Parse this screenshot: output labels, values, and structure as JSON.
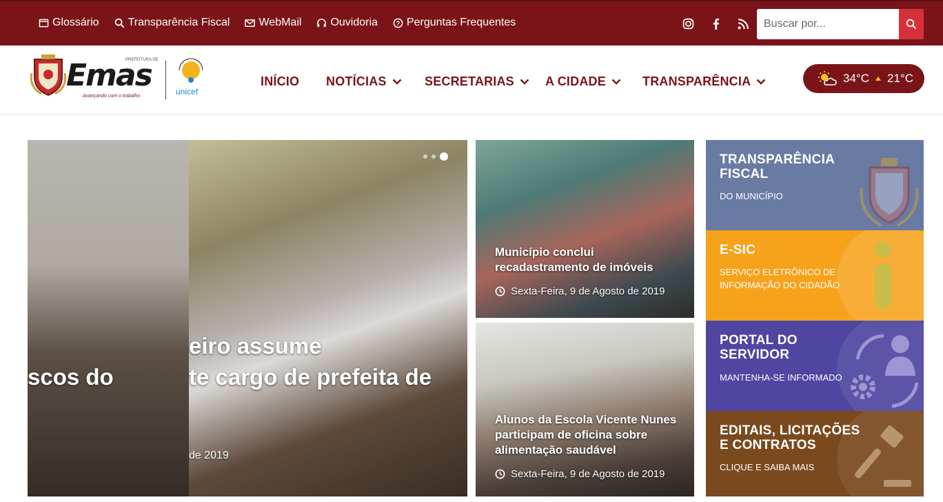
{
  "topbar": {
    "links": [
      {
        "label": "Glossário",
        "icon": "book-icon"
      },
      {
        "label": "Transparência Fiscal",
        "icon": "search-icon"
      },
      {
        "label": "WebMail",
        "icon": "envelope-icon"
      },
      {
        "label": "Ouvidoria",
        "icon": "headset-icon"
      },
      {
        "label": "Perguntas Frequentes",
        "icon": "question-circle-icon"
      }
    ],
    "socials": [
      "instagram-icon",
      "facebook-icon",
      "rss-icon"
    ],
    "search_placeholder": "Buscar por..."
  },
  "header": {
    "logo_text": "Emas",
    "logo_prefix": "PREFEITURA DE",
    "logo_tagline": "Avançando com o trabalho",
    "partner_text": "unicef",
    "nav": [
      "INÍCIO",
      "NOTÍCIAS",
      "SECRETARIAS",
      "A CIDADE",
      "TRANSPARÊNCIA"
    ],
    "weather": {
      "max": "34°C",
      "min": "21°C"
    }
  },
  "slider": {
    "slide_prev_title": "scos do",
    "slide_title_line1": "eiro assume",
    "slide_title_line2": "te cargo de prefeita de",
    "slide_date": "de 2019",
    "active_index": 2,
    "dot_count": 3
  },
  "news": [
    {
      "title": "Município conclui recadastramento de imóveis",
      "date": "Sexta-Feira, 9 de Agosto de 2019"
    },
    {
      "title": "Alunos da Escola Vicente Nunes participam de oficina sobre alimentação saudável",
      "date": "Sexta-Feira, 9 de Agosto de 2019"
    }
  ],
  "blocks": [
    {
      "title": "TRANSPARÊNCIA FISCAL",
      "subtitle": "DO MUNICÍPIO",
      "color": "#6a7ba3"
    },
    {
      "title": "E-SIC",
      "subtitle": "SERVIÇO ELETRÔNICO DE INFORMAÇÃO DO CIDADÃO",
      "color": "#f7a21b"
    },
    {
      "title": "PORTAL DO SERVIDOR",
      "subtitle": "MANTENHA-SE INFORMADO",
      "color": "#4e46a0"
    },
    {
      "title": "EDITAIS, LICITAÇÕES E CONTRATOS",
      "subtitle": "CLIQUE E SAIBA MAIS",
      "color": "#7a4a1e"
    }
  ],
  "colors": {
    "brand": "#7a1418",
    "search_button": "#d6313a"
  }
}
